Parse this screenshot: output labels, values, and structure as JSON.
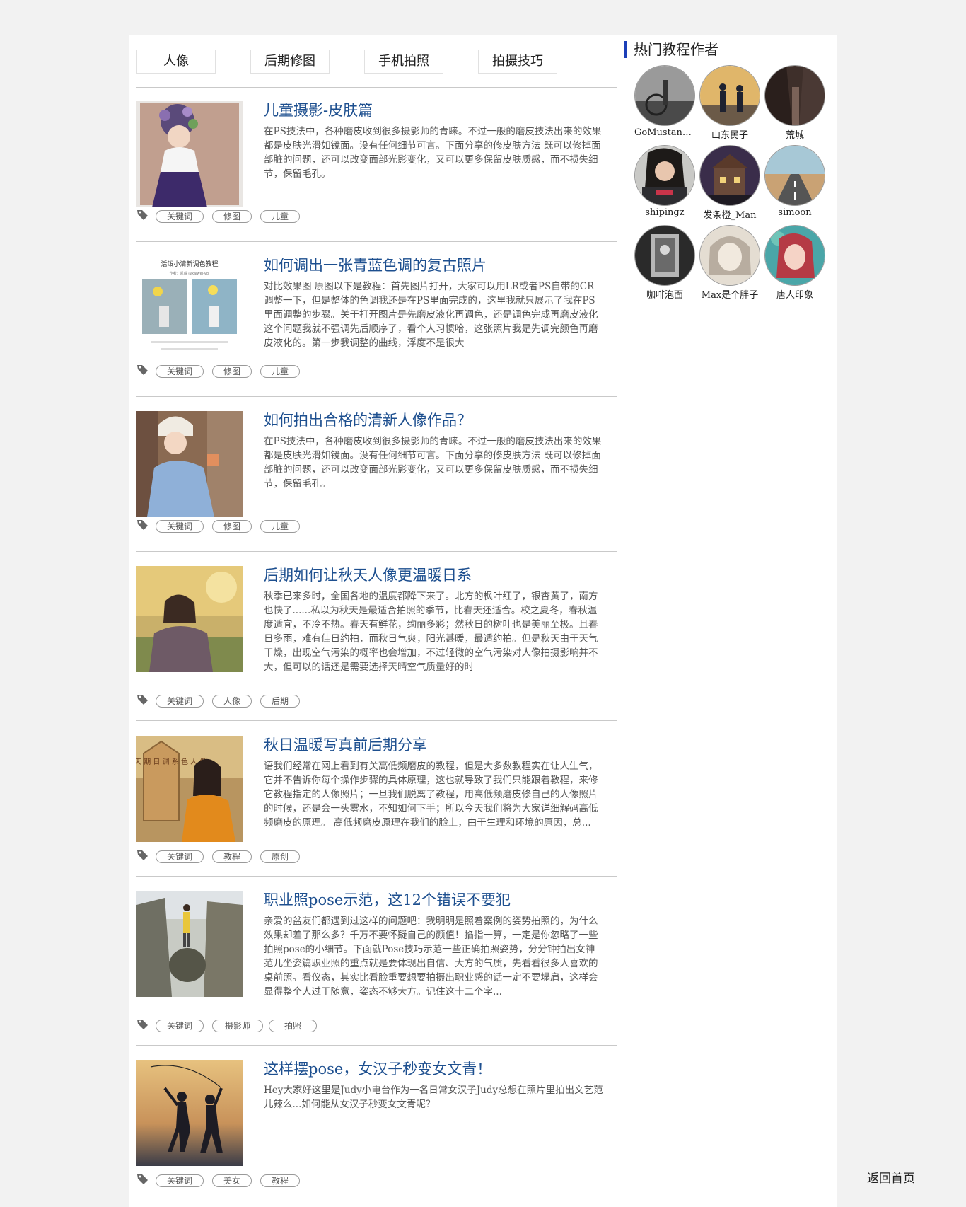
{
  "tabs": [
    "人像",
    "后期修图",
    "手机拍照",
    "拍摄技巧"
  ],
  "articles": [
    {
      "title": "儿童摄影-皮肤篇",
      "desc": "在PS技法中，各种磨皮收到很多摄影师的青睐。不过一般的磨皮技法出来的效果都是皮肤光滑如镜面。没有任何细节可言。下面分享的修皮肤方法 既可以修掉面部脏的问题，还可以改变面部光影变化，又可以更多保留皮肤质感，而不损失细节，保留毛孔。",
      "tags": [
        "关键词",
        "修图",
        "儿童"
      ]
    },
    {
      "title": "如何调出一张青蓝色调的复古照片",
      "desc": "对比效果图 原图以下是教程：首先图片打开，大家可以用LR或者PS自带的CR调整一下，但是整体的色调我还是在PS里面完成的，这里我就只展示了我在PS里面调整的步骤。关于打开图片是先磨皮液化再调色，还是调色完成再磨皮液化这个问题我就不强调先后顺序了，看个人习惯哈，这张照片我是先调完颜色再磨皮液化的。第一步我调整的曲线，浮度不是很大",
      "tags": [
        "关键词",
        "修图",
        "儿童"
      ],
      "thumb_text": [
        "活泼小清新调色教程",
        "作者：凯威 @kaiwei-ydl"
      ]
    },
    {
      "title": "如何拍出合格的清新人像作品？",
      "desc": "在PS技法中，各种磨皮收到很多摄影师的青睐。不过一般的磨皮技法出来的效果都是皮肤光滑如镜面。没有任何细节可言。下面分享的修皮肤方法 既可以修掉面部脏的问题，还可以改变面部光影变化，又可以更多保留皮肤质感，而不损失细节，保留毛孔。",
      "tags": [
        "关键词",
        "修图",
        "儿童"
      ]
    },
    {
      "title": "后期如何让秋天人像更温暖日系",
      "desc": "秋季已来多时，全国各地的温度都降下来了。北方的枫叶红了，银杏黄了，南方也快了......私以为秋天是最适合拍照的季节，比春天还适合。校之夏冬，春秋温度适宜，不冷不热。春天有鲜花，绚丽多彩；然秋日的树叶也是美丽至极。且春日多雨，难有佳日约拍，而秋日气爽，阳光甚暖，最适约拍。但是秋天由于天气干燥，出现空气污染的概率也会增加，不过轻微的空气污染对人像拍摄影响并不大，但可以的话还是需要选择天晴空气质量好的时",
      "tags": [
        "关键词",
        "人像",
        "后期"
      ]
    },
    {
      "title": "秋日温暖写真前后期分享",
      "desc": "语我们经常在网上看到有关高低频磨皮的教程，但是大多数教程实在让人生气，它并不告诉你每个操作步骤的具体原理，这也就导致了我们只能跟着教程，来修它教程指定的人像照片；一旦我们脱离了教程，用高低频磨皮修自己的人像照片的时候，还是会一头雾水，不知如何下手；所以今天我们将为大家详细解码高低频磨皮的原理。 高低频磨皮原理在我们的脸上，由于生理和环境的原因，总...",
      "tags": [
        "关键词",
        "教程",
        "原创"
      ],
      "thumb_text": "秋 后 天 期 日 调 系 色 人 像"
    },
    {
      "title": "职业照pose示范，这12个错误不要犯",
      "desc": "亲爱的盆友们都遇到过这样的问题吧：我明明是照着案例的姿势拍照的，为什么效果却差了那么多？千万不要怀疑自己的颜值！掐指一算，一定是你忽略了一些拍照pose的小细节。下面就Pose技巧示范一些正确拍照姿势，分分钟拍出女神范儿坐姿篇职业照的重点就是要体现出自信、大方的气质，先看看很多人喜欢的桌前照。看仪态，其实比看脸重要想要拍摄出职业感的话一定不要塌肩，这样会显得整个人过于随意，姿态不够大方。记住这十二个字...",
      "tags": [
        "关键词",
        "摄影师",
        "拍照"
      ]
    },
    {
      "title": "这样摆pose，女汉子秒变女文青！",
      "desc": "Hey大家好这里是Judy小电台作为一名日常女汉子Judy总想在照片里拍出文艺范儿辣么...如何能从女汉子秒变女文青呢？",
      "tags": [
        "关键词",
        "美女",
        "教程"
      ]
    }
  ],
  "sidebar": {
    "title": "热门教程作者",
    "authors": [
      "GoMustang…",
      "山东民子",
      "荒城",
      "shipingz",
      "发条橙_Man",
      "simoon",
      "咖啡泡面",
      "Max是个胖子",
      "唐人印象"
    ]
  },
  "back_home": "返回首页",
  "colors": {
    "title_blue": "#1d4f8f",
    "side_accent": "#1c3fb8"
  }
}
